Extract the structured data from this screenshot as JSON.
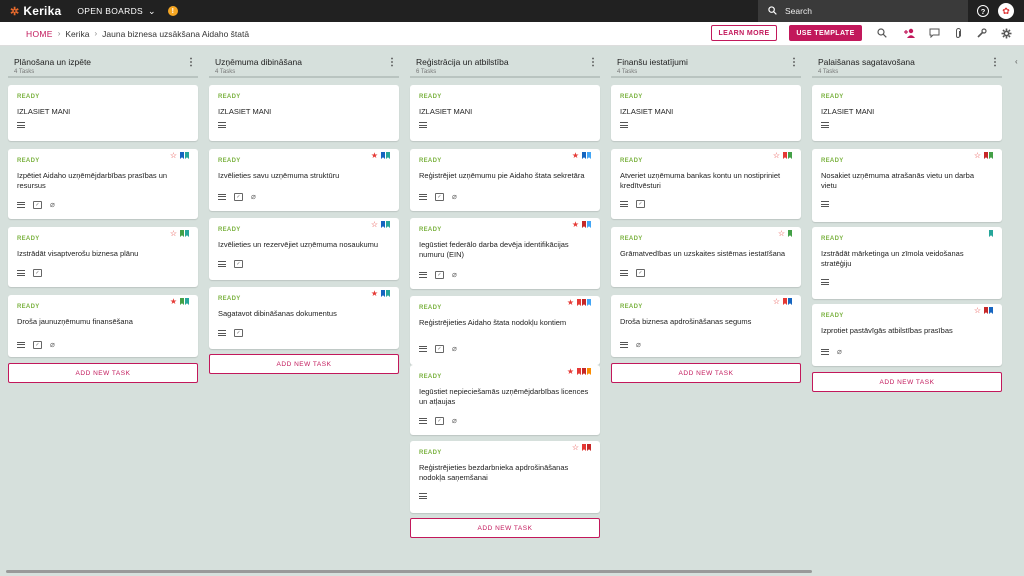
{
  "app": {
    "name": "Kerika",
    "open_boards": "OPEN BOARDS",
    "search_placeholder": "Search"
  },
  "breadcrumb": {
    "home": "HOME",
    "account": "Kerika",
    "board": "Jauna biznesa uzsākšana Aidaho štatā"
  },
  "buttons": {
    "learn_more": "LEARN MORE",
    "use_template": "USE TEMPLATE",
    "add_task": "ADD NEW TASK"
  },
  "colors": {
    "accent": "#c2185b",
    "ready": "#7cb342",
    "red": "#e53935",
    "blue": "#1565c0",
    "green": "#43a047",
    "teal": "#26a69a",
    "orange": "#fb8c00",
    "lightblue": "#42a5f5",
    "darkred": "#c62828"
  },
  "columns": [
    {
      "title": "Plānošana un izpēte",
      "count": "4 Tasks",
      "cards": [
        {
          "status": "READY",
          "title": "IZLASIET MANI",
          "star": "",
          "flags": [],
          "icons": [
            "desc"
          ]
        },
        {
          "status": "READY",
          "title": "Izpētiet Aidaho uzņēmējdarbības prasības un resursus",
          "star": "outline",
          "flags": [
            "blue",
            "teal"
          ],
          "icons": [
            "desc",
            "check",
            "clip"
          ]
        },
        {
          "status": "READY",
          "title": "Izstrādāt visaptverošu biznesa plānu",
          "star": "outline",
          "flags": [
            "green",
            "teal"
          ],
          "icons": [
            "desc",
            "check"
          ]
        },
        {
          "status": "READY",
          "title": "Droša jaunuzņēmumu finansēšana",
          "star": "filled",
          "flags": [
            "green",
            "teal"
          ],
          "icons": [
            "desc",
            "check",
            "clip"
          ]
        }
      ]
    },
    {
      "title": "Uzņēmuma dibināšana",
      "count": "4 Tasks",
      "cards": [
        {
          "status": "READY",
          "title": "IZLASIET MANI",
          "star": "",
          "flags": [],
          "icons": [
            "desc"
          ]
        },
        {
          "status": "READY",
          "title": "Izvēlieties savu uzņēmuma struktūru",
          "star": "filled",
          "flags": [
            "blue",
            "teal"
          ],
          "icons": [
            "desc",
            "check",
            "clip"
          ]
        },
        {
          "status": "READY",
          "title": "Izvēlieties un rezervējiet uzņēmuma nosaukumu",
          "star": "outline",
          "flags": [
            "blue",
            "teal"
          ],
          "icons": [
            "desc",
            "check"
          ]
        },
        {
          "status": "READY",
          "title": "Sagatavot dibināšanas dokumentus",
          "star": "filled",
          "flags": [
            "blue",
            "teal"
          ],
          "icons": [
            "desc",
            "check"
          ]
        }
      ]
    },
    {
      "title": "Reģistrācija un atbilstība",
      "count": "6 Tasks",
      "cards": [
        {
          "status": "READY",
          "title": "IZLASIET MANI",
          "star": "",
          "flags": [],
          "icons": [
            "desc"
          ]
        },
        {
          "status": "READY",
          "title": "Reģistrējiet uzņēmumu pie Aidaho štata sekretāra",
          "star": "filled",
          "flags": [
            "blue",
            "lightblue"
          ],
          "icons": [
            "desc",
            "check",
            "clip"
          ]
        },
        {
          "status": "READY",
          "title": "Iegūstiet federālo darba devēja identifikācijas numuru (EIN)",
          "star": "filled",
          "flags": [
            "darkred",
            "lightblue"
          ],
          "icons": [
            "desc",
            "check",
            "clip"
          ]
        },
        {
          "status": "READY",
          "title": "Reģistrējieties Aidaho štata nodokļu kontiem",
          "star": "filled",
          "flags": [
            "red",
            "darkred",
            "lightblue"
          ],
          "icons": [
            "desc",
            "check",
            "clip"
          ]
        },
        {
          "status": "READY",
          "title": "Iegūstiet nepieciešamās uzņēmējdarbības licences un atļaujas",
          "star": "filled",
          "flags": [
            "red",
            "darkred",
            "orange"
          ],
          "icons": [
            "desc",
            "check",
            "clip"
          ]
        },
        {
          "status": "READY",
          "title": "Reģistrējieties bezdarbnieka apdrošināšanas nodokļa saņemšanai",
          "star": "outline",
          "flags": [
            "red",
            "darkred"
          ],
          "icons": [
            "desc"
          ]
        }
      ]
    },
    {
      "title": "Finanšu iestatījumi",
      "count": "4 Tasks",
      "cards": [
        {
          "status": "READY",
          "title": "IZLASIET MANI",
          "star": "",
          "flags": [],
          "icons": [
            "desc"
          ]
        },
        {
          "status": "READY",
          "title": "Atveriet uzņēmuma bankas kontu un nostipriniet kredītvēsturi",
          "star": "outline",
          "flags": [
            "red",
            "green"
          ],
          "icons": [
            "desc",
            "check"
          ]
        },
        {
          "status": "READY",
          "title": "Grāmatvedības un uzskaites sistēmas iestatīšana",
          "star": "outline",
          "flags": [
            "green"
          ],
          "icons": [
            "desc",
            "check"
          ]
        },
        {
          "status": "READY",
          "title": "Droša biznesa apdrošināšanas segums",
          "star": "outline",
          "flags": [
            "red",
            "blue"
          ],
          "icons": [
            "desc",
            "clip"
          ]
        }
      ]
    },
    {
      "title": "Palaišanas sagatavošana",
      "count": "4 Tasks",
      "cards": [
        {
          "status": "READY",
          "title": "IZLASIET MANI",
          "star": "",
          "flags": [],
          "icons": [
            "desc"
          ]
        },
        {
          "status": "READY",
          "title": "Nosakiet uzņēmuma atrašanās vietu un darba vietu",
          "star": "outline",
          "flags": [
            "darkred",
            "green"
          ],
          "icons": [
            "desc"
          ]
        },
        {
          "status": "READY",
          "title": "Izstrādāt mārketinga un zīmola veidošanas stratēģiju",
          "star": "",
          "flags": [
            "teal"
          ],
          "icons": [
            "desc"
          ]
        },
        {
          "status": "READY",
          "title": "Izprotiet pastāvīgās atbilstības prasības",
          "star": "outline",
          "flags": [
            "darkred",
            "blue"
          ],
          "icons": [
            "desc",
            "clip"
          ]
        }
      ]
    }
  ]
}
